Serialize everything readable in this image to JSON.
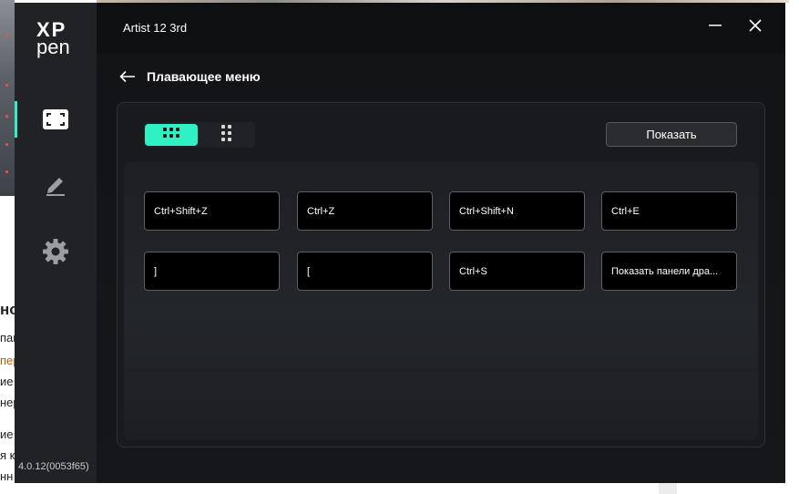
{
  "background": {
    "side_lines": [
      "но",
      "пан",
      "пер",
      "ие",
      "нер",
      "ие",
      "я к",
      "нн"
    ]
  },
  "window": {
    "title": "Artist 12 3rd",
    "controls": {
      "minimize": "—",
      "close": "✕"
    }
  },
  "logo": {
    "line1": "XP",
    "line2": "pen"
  },
  "sidebar": {
    "items": [
      {
        "name": "screen",
        "icon": "screen-frame-icon",
        "active": true
      },
      {
        "name": "pen",
        "icon": "pen-icon",
        "active": false
      },
      {
        "name": "settings",
        "icon": "gear-icon",
        "active": false
      }
    ],
    "version": "4.0.12(0053f65)"
  },
  "page": {
    "back_icon": "arrow-left-icon",
    "title": "Плавающее меню"
  },
  "toolbar": {
    "view_options": [
      {
        "icon": "grid-view-icon",
        "selected": true
      },
      {
        "icon": "column-view-icon",
        "selected": false
      }
    ],
    "show_label": "Показать"
  },
  "shortcuts": [
    "Ctrl+Shift+Z",
    "Ctrl+Z",
    "Ctrl+Shift+N",
    "Ctrl+E",
    "]",
    "[",
    "Ctrl+S",
    "Показать панели дра..."
  ],
  "colors": {
    "accent": "#2ef2c4",
    "sidebar": "#202226",
    "titlebar": "#0e0f11",
    "key_bg": "#000000"
  }
}
